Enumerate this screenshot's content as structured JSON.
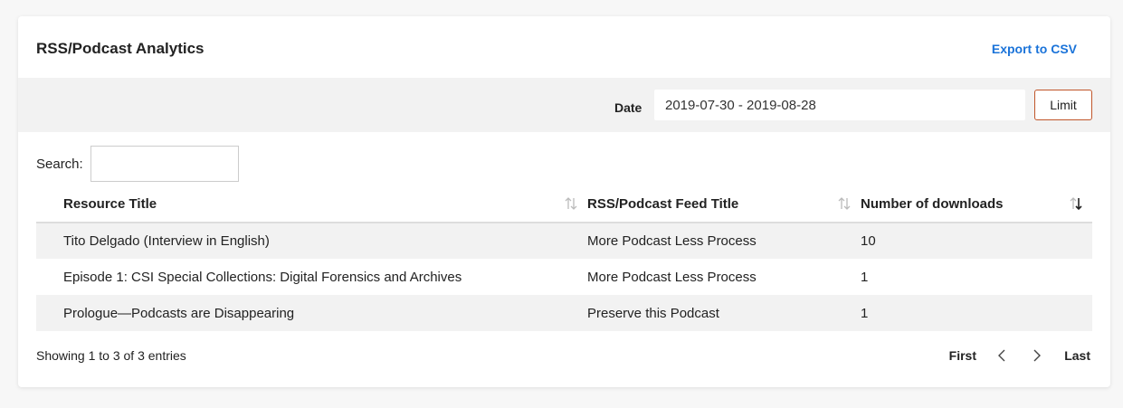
{
  "header": {
    "title": "RSS/Podcast Analytics",
    "export_label": "Export to CSV"
  },
  "filter": {
    "date_label": "Date",
    "date_value": "2019-07-30 - 2019-08-28",
    "limit_label": "Limit"
  },
  "search": {
    "label": "Search:",
    "value": ""
  },
  "table": {
    "columns": [
      "Resource Title",
      "RSS/Podcast Feed Title",
      "Number of downloads"
    ],
    "rows": [
      [
        "Tito Delgado (Interview in English)",
        "More Podcast Less Process",
        "10"
      ],
      [
        "Episode 1: CSI Special Collections: Digital Forensics and Archives",
        "More Podcast Less Process",
        "1"
      ],
      [
        "Prologue—Podcasts are Disappearing",
        "Preserve this Podcast",
        "1"
      ]
    ],
    "sorted_column": "Number of downloads",
    "sort_direction": "descending"
  },
  "footer": {
    "info": "Showing 1 to 3 of 3 entries",
    "first_label": "First",
    "last_label": "Last"
  },
  "colors": {
    "accent_link": "#1a73d9",
    "limit_border": "#c0562a",
    "filter_bar_bg": "#f2f2f2"
  },
  "icons": [
    "sort-icon",
    "sort-desc-icon",
    "chevron-left-icon",
    "chevron-right-icon"
  ]
}
